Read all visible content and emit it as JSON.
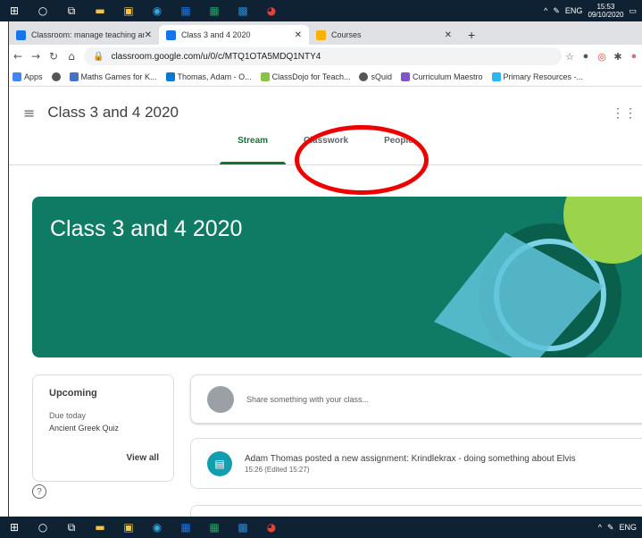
{
  "taskbar": {
    "clock_time": "15:53",
    "clock_date": "09/10/2020",
    "lang": "ENG",
    "bottom_lang": "ENG"
  },
  "browser": {
    "tabs": [
      {
        "label": "Classroom: manage teaching an...",
        "color": "#1a73e8"
      },
      {
        "label": "Class 3 and 4 2020",
        "color": "#1a73e8"
      },
      {
        "label": "Courses",
        "color": "#f4b400"
      }
    ],
    "url": "classroom.google.com/u/0/c/MTQ1OTA5MDQ1NTY4",
    "bookmarks": [
      {
        "label": "Apps"
      },
      {
        "label": ""
      },
      {
        "label": "Maths Games for K..."
      },
      {
        "label": "Thomas, Adam - O..."
      },
      {
        "label": "ClassDojo for Teach..."
      },
      {
        "label": "sQuid"
      },
      {
        "label": "Curriculum Maestro"
      },
      {
        "label": "Primary Resources -..."
      }
    ]
  },
  "page": {
    "class_title": "Class 3 and 4 2020",
    "nav_tabs": [
      "Stream",
      "Classwork",
      "People"
    ],
    "banner_title": "Class 3 and 4 2020",
    "banner_color": "#0f7b65",
    "upcoming": {
      "title": "Upcoming",
      "due": "Due today",
      "item": "Ancient Greek Quiz",
      "view_all": "View all"
    },
    "share_placeholder": "Share something with your class...",
    "post": {
      "title": "Adam Thomas posted a new assignment: Krindlekrax - doing something about Elvis",
      "time": "15:26 (Edited 15:27)"
    }
  }
}
